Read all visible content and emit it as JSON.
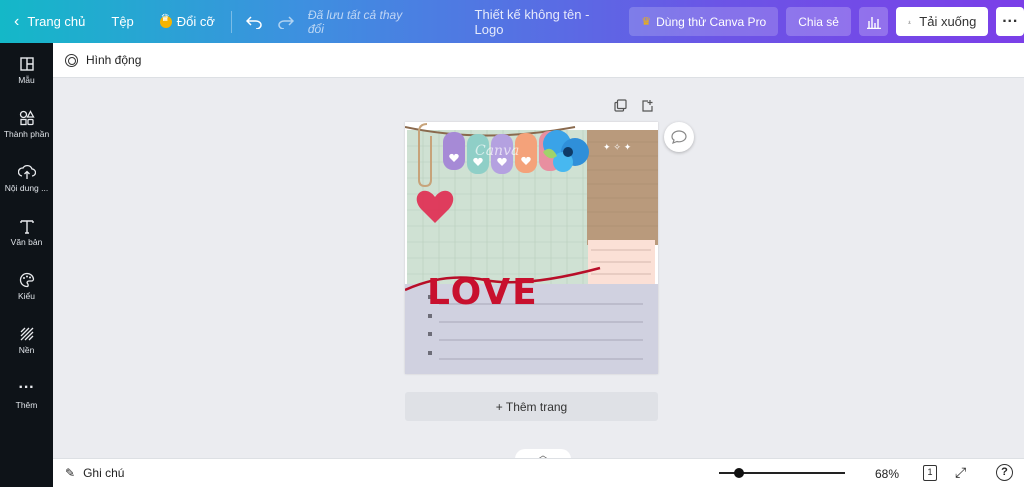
{
  "topbar": {
    "home": "Trang chủ",
    "file": "Tệp",
    "resize": "Đổi cỡ",
    "saved_status": "Đã lưu tất cả thay đổi",
    "doc_title": "Thiết kế không tên - Logo",
    "try_pro": "Dùng thử Canva Pro",
    "share": "Chia sẻ",
    "download": "Tải xuống"
  },
  "sidebar": {
    "items": [
      {
        "label": "Mẫu",
        "icon": "template-icon"
      },
      {
        "label": "Thành phần",
        "icon": "elements-icon"
      },
      {
        "label": "Nội dung ...",
        "icon": "upload-icon"
      },
      {
        "label": "Văn bản",
        "icon": "text-icon"
      },
      {
        "label": "Kiểu",
        "icon": "styles-icon"
      },
      {
        "label": "Nền",
        "icon": "background-icon"
      },
      {
        "label": "Thêm",
        "icon": "more-icon"
      }
    ]
  },
  "toolbar": {
    "animate": "Hình động"
  },
  "canvas": {
    "add_page": "+ Thêm trang",
    "design_text": "LOVE",
    "watermark": "Canva"
  },
  "footer": {
    "notes": "Ghi chú",
    "zoom": 68,
    "zoom_label": "68%",
    "page_number": "1"
  },
  "colors": {
    "accent": "#7b3fe8",
    "sidebar_bg": "#0e1318",
    "love_red": "#c8102e"
  }
}
